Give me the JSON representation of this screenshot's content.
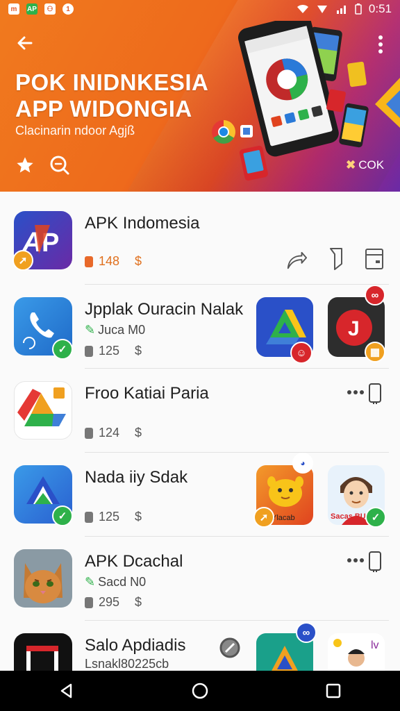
{
  "status_bar": {
    "time": "0:51"
  },
  "header": {
    "title_line1": "POK INIDNKESIA",
    "title_line2": "APP WIDONGIA",
    "subtitle": "Clacinarin ndoor Agjß",
    "right_label": "COK"
  },
  "apps": [
    {
      "name": "APK Indomesia",
      "size": "148",
      "price": "$",
      "icon_text": "AP"
    },
    {
      "name": "Jpplak Ouracin Nalak",
      "sub": "Juca M0",
      "size": "125",
      "price": "$"
    },
    {
      "name": "Froo Katiai Paria",
      "size": "124",
      "price": "$"
    },
    {
      "name": "Nada iiy Sdak",
      "size": "125",
      "price": "$",
      "side_caption_1": "Ylacab",
      "side_caption_2": "Sacas BUC"
    },
    {
      "name": "APK Dcachal",
      "sub": "Sacd N0",
      "size": "295",
      "price": "$"
    },
    {
      "name": "Salo Apdiadis",
      "sub": "Lsnakl80225cb",
      "size": "",
      "price": ""
    }
  ],
  "colors": {
    "header_orange": "#f07a1e",
    "header_purple": "#6a2aa6",
    "badge_green": "#2eb14a",
    "accent_orange": "#e0701e"
  }
}
